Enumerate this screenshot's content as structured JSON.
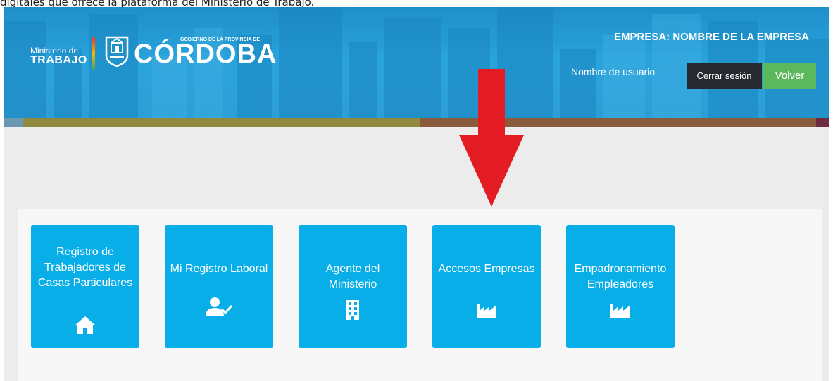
{
  "caption": "digitales que ofrece la plataforma del Ministerio de Trabajo.",
  "header": {
    "ministerio_small": "Ministerio de",
    "ministerio_big": "TRABAJO",
    "gobierno_small": "GOBIERNO DE LA PROVINCIA DE",
    "cordoba": "CÓRDOBA",
    "empresa_label": "EMPRESA: NOMBRE DE LA EMPRESA",
    "username": "Nombre de usuario",
    "logout_label": "Cerrar sesión",
    "back_label": "Volver"
  },
  "tiles": [
    {
      "label": "Registro de Trabajadores de Casas Particulares",
      "icon": "home-icon"
    },
    {
      "label": "Mi Registro Laboral",
      "icon": "user-check-icon"
    },
    {
      "label": "Agente del Ministerio",
      "icon": "building-icon"
    },
    {
      "label": "Accesos Empresas",
      "icon": "factory-icon"
    },
    {
      "label": "Empadronamiento Empleadores",
      "icon": "factory-icon"
    }
  ],
  "colors": {
    "header_blue": "#2aa3dc",
    "tile_blue": "#08aee8",
    "logout_dark": "#262a30",
    "back_green": "#5cb85c",
    "arrow_red": "#e31b23",
    "stripe_olive": "#8f8a3e",
    "stripe_brown": "#8a5a3c"
  },
  "annotation": {
    "arrow": "red-down-arrow-icon"
  }
}
